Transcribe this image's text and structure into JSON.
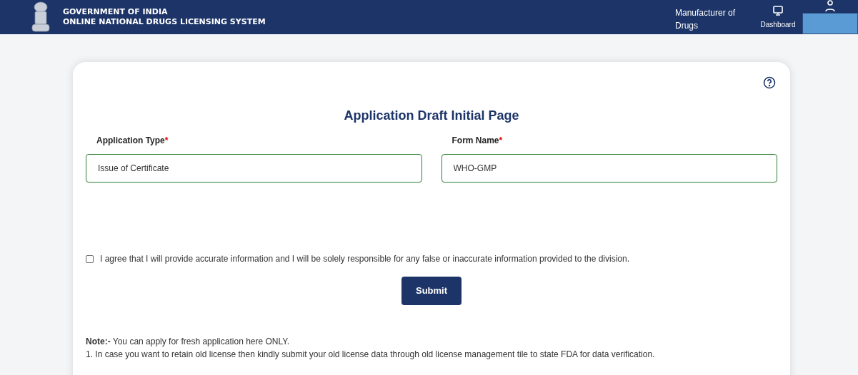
{
  "header": {
    "title_line_1": "GOVERNMENT OF INDIA",
    "title_line_2": "ONLINE NATIONAL DRUGS LICENSING SYSTEM",
    "role": "Manufacturer of Drugs",
    "dashboard_label": "Dashboard"
  },
  "card": {
    "title": "Application Draft Initial Page",
    "fields": [
      {
        "label": "Application Type",
        "required_mark": "*",
        "value": "Issue of Certificate"
      },
      {
        "label": "Form Name",
        "required_mark": "*",
        "value": "WHO-GMP"
      }
    ],
    "agreement": {
      "checked": false,
      "text": "I agree that I will provide accurate information and I will be solely responsible for any false or inaccurate information provided to the division."
    },
    "submit_label": "Submit",
    "note_label": "Note:-",
    "note_text": "You can apply for fresh application here ONLY.",
    "note_lines": [
      "1. In case you want to retain old license then kindly submit your old license data through old license management tile to state FDA for data verification."
    ]
  }
}
